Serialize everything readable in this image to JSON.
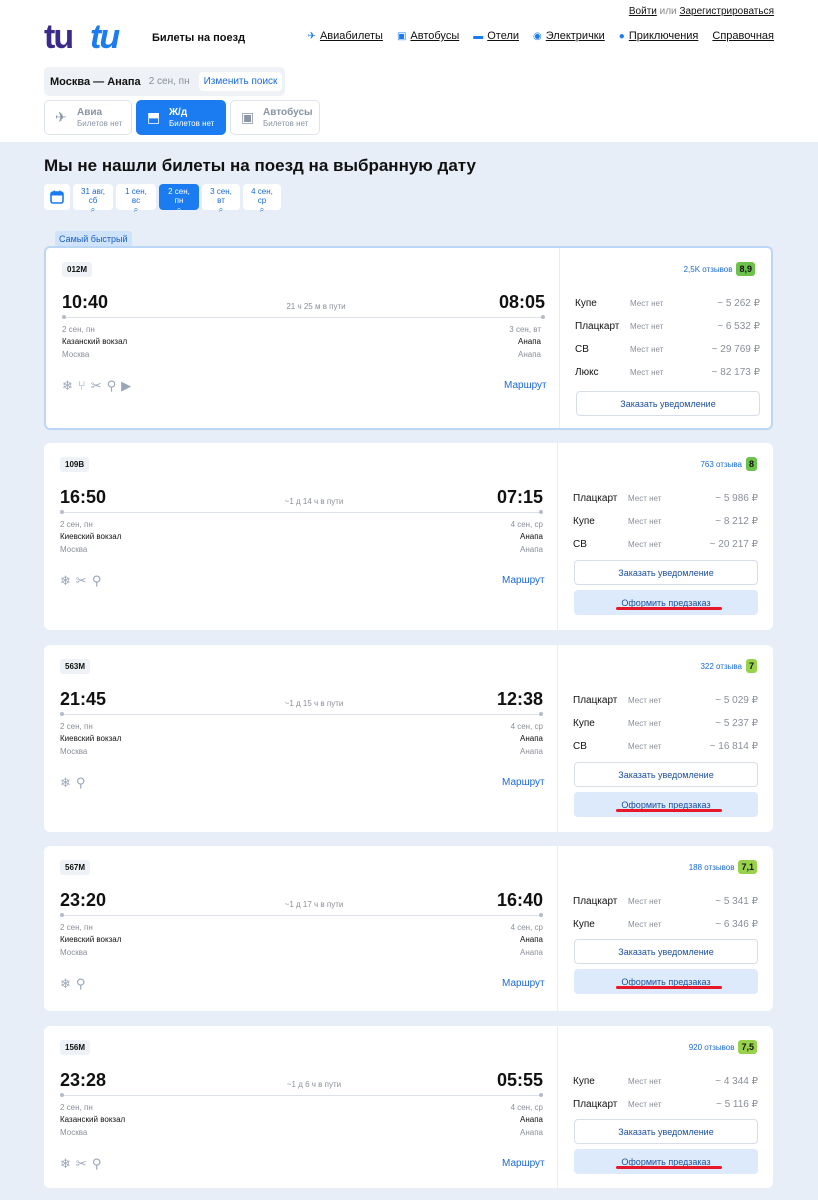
{
  "header": {
    "logo_text": "tutu",
    "subtitle": "Билеты на поезд",
    "auth": {
      "login": "Войти",
      "or": "или",
      "register": "Зарегистрироваться"
    },
    "nav": [
      {
        "label": "Авиабилеты",
        "icon": "plane-icon",
        "glyph": "✈"
      },
      {
        "label": "Автобусы",
        "icon": "bus-icon",
        "glyph": "▣"
      },
      {
        "label": "Отели",
        "icon": "bed-icon",
        "glyph": "▬"
      },
      {
        "label": "Электрички",
        "icon": "train-icon",
        "glyph": "◉"
      },
      {
        "label": "Приключения",
        "icon": "pin-icon",
        "glyph": "●"
      },
      {
        "label": "Справочная",
        "icon": "",
        "glyph": ""
      }
    ]
  },
  "search": {
    "route": "Москва — Анапа",
    "date": "2 сен, пн",
    "change_label": "Изменить поиск"
  },
  "tabs": [
    {
      "title": "Авиа",
      "sub": "Билетов нет",
      "glyph": "✈"
    },
    {
      "title": "Ж/д",
      "sub": "Билетов нет",
      "glyph": "⬒"
    },
    {
      "title": "Автобусы",
      "sub": "Билетов нет",
      "glyph": "▣"
    }
  ],
  "title": "Мы не нашли билеты на поезд на выбранную дату",
  "dates": [
    "31 авг, сб",
    "1 сен, вс",
    "2 сен, пн",
    "3 сен, вт",
    "4 сен, ср"
  ],
  "fast_badge": "Самый быстрый",
  "common": {
    "route_link": "Маршрут",
    "notify": "Заказать уведомление",
    "preorder": "Оформить предзаказ",
    "no_seats": "Места нет"
  },
  "trains": [
    {
      "number": "012М",
      "dep": "10:40",
      "arr": "08:05",
      "duration": "21 ч 25 м в пути",
      "dep_date": "2 сен, пн",
      "arr_date": "3 сен, вт",
      "dep_station": "Казанский вокзал",
      "arr_station": "Анапа",
      "dep_city": "Москва",
      "arr_city": "Анапа",
      "reviews": "2,5K отзывов",
      "rating": "8,9",
      "rating_color": "#6cc24a",
      "amenities": [
        "snowflake-icon",
        "food-icon",
        "restaurant-icon",
        "wc-icon",
        "tv-icon"
      ],
      "classes": [
        {
          "name": "Купе",
          "avail": "Мест нет",
          "price": "~ 5 262 ₽"
        },
        {
          "name": "Плацкарт",
          "avail": "Мест нет",
          "price": "~ 6 532 ₽"
        },
        {
          "name": "СВ",
          "avail": "Мест нет",
          "price": "~ 29 769 ₽"
        },
        {
          "name": "Люкс",
          "avail": "Мест нет",
          "price": "~ 82 173 ₽"
        }
      ],
      "preorder": false
    },
    {
      "number": "109В",
      "dep": "16:50",
      "arr": "07:15",
      "duration": "~1 д 14 ч в пути",
      "dep_date": "2 сен, пн",
      "arr_date": "4 сен, ср",
      "dep_station": "Киевский вокзал",
      "arr_station": "Анапа",
      "dep_city": "Москва",
      "arr_city": "Анапа",
      "reviews": "763 отзыва",
      "rating": "8",
      "rating_color": "#6cc24a",
      "amenities": [
        "snowflake-icon",
        "restaurant-icon",
        "wc-icon"
      ],
      "classes": [
        {
          "name": "Плацкарт",
          "avail": "Мест нет",
          "price": "~ 5 986 ₽"
        },
        {
          "name": "Купе",
          "avail": "Мест нет",
          "price": "~ 8 212 ₽"
        },
        {
          "name": "СВ",
          "avail": "Мест нет",
          "price": "~ 20 217 ₽"
        }
      ],
      "preorder": true
    },
    {
      "number": "563М",
      "dep": "21:45",
      "arr": "12:38",
      "duration": "~1 д 15 ч в пути",
      "dep_date": "2 сен, пн",
      "arr_date": "4 сен, ср",
      "dep_station": "Киевский вокзал",
      "arr_station": "Анапа",
      "dep_city": "Москва",
      "arr_city": "Анапа",
      "reviews": "322 отзыва",
      "rating": "7",
      "rating_color": "#98d24a",
      "amenities": [
        "snowflake-icon",
        "wc-icon"
      ],
      "classes": [
        {
          "name": "Плацкарт",
          "avail": "Мест нет",
          "price": "~ 5 029 ₽"
        },
        {
          "name": "Купе",
          "avail": "Мест нет",
          "price": "~ 5 237 ₽"
        },
        {
          "name": "СВ",
          "avail": "Мест нет",
          "price": "~ 16 814 ₽"
        }
      ],
      "preorder": true
    },
    {
      "number": "567М",
      "dep": "23:20",
      "arr": "16:40",
      "duration": "~1 д 17 ч в пути",
      "dep_date": "2 сен, пн",
      "arr_date": "4 сен, ср",
      "dep_station": "Киевский вокзал",
      "arr_station": "Анапа",
      "dep_city": "Москва",
      "arr_city": "Анапа",
      "reviews": "188 отзывов",
      "rating": "7,1",
      "rating_color": "#98d24a",
      "amenities": [
        "snowflake-icon",
        "wc-icon"
      ],
      "classes": [
        {
          "name": "Плацкарт",
          "avail": "Мест нет",
          "price": "~ 5 341 ₽"
        },
        {
          "name": "Купе",
          "avail": "Мест нет",
          "price": "~ 6 346 ₽"
        }
      ],
      "preorder": true
    },
    {
      "number": "156М",
      "dep": "23:28",
      "arr": "05:55",
      "duration": "~1 д 6 ч в пути",
      "dep_date": "2 сен, пн",
      "arr_date": "4 сен, ср",
      "dep_station": "Казанский вокзал",
      "arr_station": "Анапа",
      "dep_city": "Москва",
      "arr_city": "Анапа",
      "reviews": "920 отзывов",
      "rating": "7,5",
      "rating_color": "#98d24a",
      "amenities": [
        "snowflake-icon",
        "restaurant-icon",
        "wc-icon"
      ],
      "classes": [
        {
          "name": "Купе",
          "avail": "Мест нет",
          "price": "~ 4 344 ₽"
        },
        {
          "name": "Плацкарт",
          "avail": "Мест нет",
          "price": "~ 5 116 ₽"
        }
      ],
      "preorder": true
    }
  ]
}
